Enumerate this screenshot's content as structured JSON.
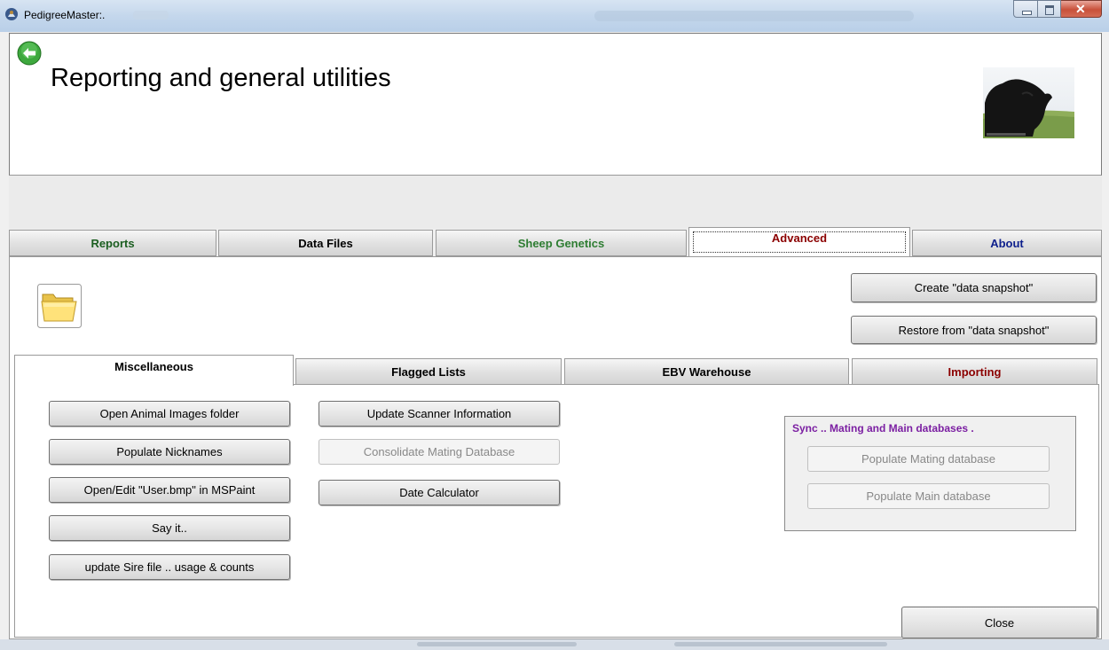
{
  "window": {
    "title": "PedigreeMaster:."
  },
  "header": {
    "title": "Reporting and general utilities"
  },
  "main_tabs": [
    {
      "label": "Reports",
      "color": "#1b5e20"
    },
    {
      "label": "Data Files",
      "color": "#000000"
    },
    {
      "label": "Sheep Genetics",
      "color": "#2e7d32"
    },
    {
      "label": "Advanced",
      "color": "#8b0000",
      "active": true
    },
    {
      "label": "About",
      "color": "#0d1f8c"
    }
  ],
  "snapshot": {
    "create_label": "Create \"data snapshot\"",
    "restore_label": "Restore from \"data snapshot\""
  },
  "sub_tabs": [
    {
      "label": "Miscellaneous",
      "color": "#000000",
      "active": true
    },
    {
      "label": "Flagged Lists",
      "color": "#000000"
    },
    {
      "label": "EBV Warehouse",
      "color": "#000000"
    },
    {
      "label": "Importing",
      "color": "#8b0000"
    }
  ],
  "misc": {
    "col1": [
      "Open Animal Images folder",
      "Populate Nicknames",
      "Open/Edit \"User.bmp\" in MSPaint",
      "Say it..",
      "update Sire file .. usage & counts"
    ],
    "col2": [
      {
        "label": "Update Scanner Information",
        "enabled": true
      },
      {
        "label": "Consolidate Mating Database",
        "enabled": false
      },
      {
        "label": "Date Calculator",
        "enabled": true
      }
    ]
  },
  "sync": {
    "title": "Sync .. Mating and Main databases .",
    "populate_mating_label": "Populate Mating database",
    "populate_main_label": "Populate Main database"
  },
  "footer": {
    "close_label": "Close"
  }
}
